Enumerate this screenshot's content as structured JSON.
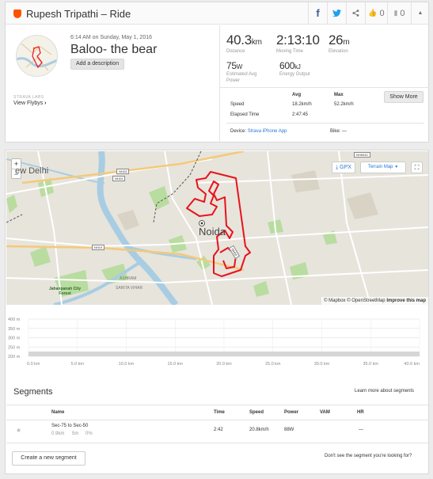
{
  "header": {
    "title": "Rupesh Tripathi – Ride",
    "kudos_count": "0",
    "comment_count": "0"
  },
  "activity": {
    "date": "6:14 AM on Sunday, May 1, 2016",
    "name": "Baloo- the bear",
    "add_description": "Add a description",
    "labs_label": "STRAVA LABS",
    "view_flybys": "View Flybys",
    "device_label": "Device:",
    "device_value": "Strava iPhone App",
    "bike_label": "Bike:",
    "bike_value": "—"
  },
  "stats": {
    "distance": {
      "value": "40.3",
      "unit": "km",
      "label": "Distance"
    },
    "moving_time": {
      "value": "2:13:10",
      "unit": "",
      "label": "Moving Time"
    },
    "elevation": {
      "value": "26",
      "unit": "m",
      "label": "Elevation"
    },
    "power": {
      "value": "75",
      "unit": "W",
      "label": "Estimated Avg Power"
    },
    "energy": {
      "value": "600",
      "unit": "kJ",
      "label": "Energy Output"
    }
  },
  "detail_table": {
    "col_avg": "Avg",
    "col_max": "Max",
    "show_more": "Show More",
    "rows": [
      {
        "label": "Speed",
        "avg": "18.2km/h",
        "max": "52.2km/h"
      },
      {
        "label": "Elapsed Time",
        "avg": "2:47:45",
        "max": ""
      }
    ]
  },
  "map": {
    "zoom_in": "+",
    "zoom_out": "−",
    "gpx_label": "GPX",
    "terrain_label": "Terrain Map",
    "labels": {
      "new_delhi": "ew Delhi",
      "noida": "Noida",
      "jahanpanah": "Jahanpanah City Forest",
      "sarita_vihar": "SARITA VIHAR",
      "ashram": "ASHRAM",
      "nh24_a": "NH24",
      "nh24_b": "NH24",
      "nh19": "NH19",
      "nh50": "NH50",
      "nh504c": "NH504C"
    },
    "attribution_a": "© Mapbox © OpenStreetMap",
    "attribution_b": "Improve this map",
    "route_color": "#e8131b"
  },
  "elevation_chart": {
    "y_labels": [
      "400 m",
      "350 m",
      "300 m",
      "250 m",
      "200 m"
    ],
    "x_labels": [
      "0.0 km",
      "5.0 km",
      "10.0 km",
      "15.0 km",
      "20.0 km",
      "25.0 km",
      "30.0 km",
      "35.0 km",
      "40.0 km"
    ]
  },
  "segments": {
    "title": "Segments",
    "learn_more": "Learn more about segments",
    "headers": {
      "name": "Name",
      "time": "Time",
      "speed": "Speed",
      "power": "Power",
      "vam": "VAM",
      "hr": "HR"
    },
    "rows": [
      {
        "name": "Sec-75 to Sec-50",
        "distance": "0.9km",
        "elevation": "5m",
        "grade": "0%",
        "time": "2:42",
        "speed": "20.8km/h",
        "power": "88W",
        "vam": "",
        "hr": "—"
      }
    ],
    "create_button": "Create a new segment",
    "dont_see": "Don't see the segment you're looking for?"
  },
  "colors": {
    "brand": "#fc5200",
    "link": "#2b78d4",
    "route": "#e8131b",
    "water": "#a8cde3",
    "park": "#a9d591"
  }
}
